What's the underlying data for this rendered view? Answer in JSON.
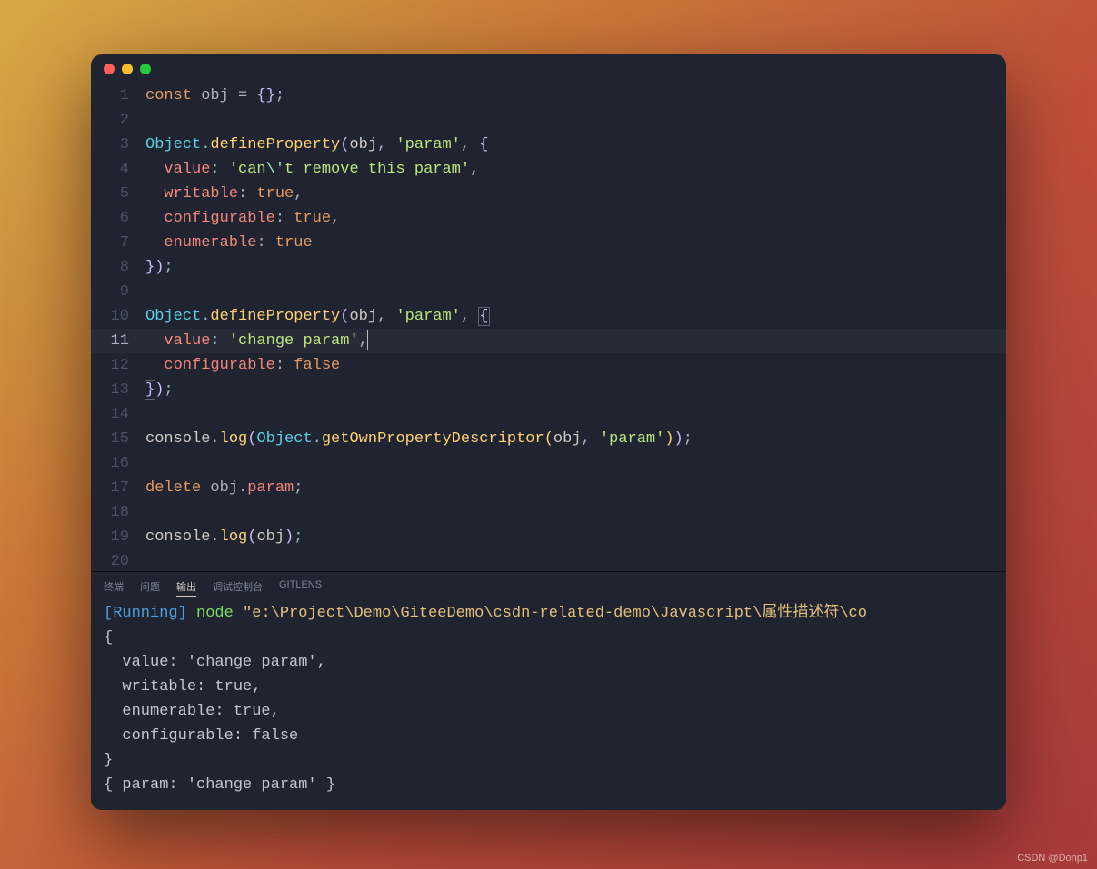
{
  "watermark": "CSDN @Donp1",
  "panel": {
    "tabs": [
      {
        "id": "terminal",
        "label": "终端",
        "active": false
      },
      {
        "id": "problems",
        "label": "问题",
        "active": false
      },
      {
        "id": "output",
        "label": "输出",
        "active": true
      },
      {
        "id": "debug",
        "label": "调试控制台",
        "active": false
      },
      {
        "id": "gitlens",
        "label": "GITLENS",
        "active": false
      }
    ],
    "run_tag": "[Running]",
    "run_cmd": " node ",
    "run_path": "\"e:\\Project\\Demo\\GiteeDemo\\csdn-related-demo\\Javascript\\属性描述符\\co",
    "output_lines": [
      "{",
      "  value: 'change param',",
      "  writable: true,",
      "  enumerable: true,",
      "  configurable: false",
      "}",
      "{ param: 'change param' }"
    ]
  },
  "editor": {
    "cursor_line": 11,
    "highlight_line": 11,
    "lines": [
      {
        "n": 1,
        "tokens": [
          [
            "kw",
            "const"
          ],
          [
            "p",
            " obj "
          ],
          [
            "p",
            "= "
          ],
          [
            "br",
            "{}"
          ],
          [
            "p",
            ";"
          ]
        ]
      },
      {
        "n": 2,
        "tokens": []
      },
      {
        "n": 3,
        "tokens": [
          [
            "obj",
            "Object"
          ],
          [
            "p",
            "."
          ],
          [
            "fn",
            "defineProperty"
          ],
          [
            "br",
            "("
          ],
          [
            "id",
            "obj"
          ],
          [
            "p",
            ", "
          ],
          [
            "str",
            "'param'"
          ],
          [
            "p",
            ", "
          ],
          [
            "br",
            "{"
          ]
        ]
      },
      {
        "n": 4,
        "tokens": [
          [
            "p",
            "  "
          ],
          [
            "prop",
            "value"
          ],
          [
            "p",
            ": "
          ],
          [
            "str",
            "'can"
          ],
          [
            "esc",
            "\\'"
          ],
          [
            "str",
            "t remove this param'"
          ],
          [
            "p",
            ","
          ]
        ]
      },
      {
        "n": 5,
        "tokens": [
          [
            "p",
            "  "
          ],
          [
            "prop",
            "writable"
          ],
          [
            "p",
            ": "
          ],
          [
            "kw",
            "true"
          ],
          [
            "p",
            ","
          ]
        ]
      },
      {
        "n": 6,
        "tokens": [
          [
            "p",
            "  "
          ],
          [
            "prop",
            "configurable"
          ],
          [
            "p",
            ": "
          ],
          [
            "kw",
            "true"
          ],
          [
            "p",
            ","
          ]
        ]
      },
      {
        "n": 7,
        "tokens": [
          [
            "p",
            "  "
          ],
          [
            "prop",
            "enumerable"
          ],
          [
            "p",
            ": "
          ],
          [
            "kw",
            "true"
          ]
        ]
      },
      {
        "n": 8,
        "tokens": [
          [
            "br",
            "}"
          ],
          [
            "br",
            ")"
          ],
          [
            "p",
            ";"
          ]
        ]
      },
      {
        "n": 9,
        "tokens": []
      },
      {
        "n": 10,
        "tokens": [
          [
            "obj",
            "Object"
          ],
          [
            "p",
            "."
          ],
          [
            "fn",
            "defineProperty"
          ],
          [
            "br",
            "("
          ],
          [
            "id",
            "obj"
          ],
          [
            "p",
            ", "
          ],
          [
            "str",
            "'param'"
          ],
          [
            "p",
            ", "
          ],
          [
            "br match-br",
            "{"
          ]
        ]
      },
      {
        "n": 11,
        "tokens": [
          [
            "p",
            "  "
          ],
          [
            "prop",
            "value"
          ],
          [
            "p",
            ": "
          ],
          [
            "str",
            "'change param'"
          ],
          [
            "p",
            ","
          ],
          [
            "cursor",
            ""
          ]
        ]
      },
      {
        "n": 12,
        "tokens": [
          [
            "p",
            "  "
          ],
          [
            "prop",
            "configurable"
          ],
          [
            "p",
            ": "
          ],
          [
            "false",
            "false"
          ]
        ]
      },
      {
        "n": 13,
        "tokens": [
          [
            "br match-br",
            "}"
          ],
          [
            "br",
            ")"
          ],
          [
            "p",
            ";"
          ]
        ]
      },
      {
        "n": 14,
        "tokens": []
      },
      {
        "n": 15,
        "tokens": [
          [
            "id",
            "console"
          ],
          [
            "p",
            "."
          ],
          [
            "fn",
            "log"
          ],
          [
            "br",
            "("
          ],
          [
            "obj",
            "Object"
          ],
          [
            "p",
            "."
          ],
          [
            "fn",
            "getOwnPropertyDescriptor"
          ],
          [
            "br2",
            "("
          ],
          [
            "id",
            "obj"
          ],
          [
            "p",
            ", "
          ],
          [
            "str",
            "'param'"
          ],
          [
            "br2",
            ")"
          ],
          [
            "br",
            ")"
          ],
          [
            "p",
            ";"
          ]
        ]
      },
      {
        "n": 16,
        "tokens": []
      },
      {
        "n": 17,
        "tokens": [
          [
            "kw",
            "delete"
          ],
          [
            "p",
            " obj"
          ],
          [
            "p",
            "."
          ],
          [
            "prop",
            "param"
          ],
          [
            "p",
            ";"
          ]
        ]
      },
      {
        "n": 18,
        "tokens": []
      },
      {
        "n": 19,
        "tokens": [
          [
            "id",
            "console"
          ],
          [
            "p",
            "."
          ],
          [
            "fn",
            "log"
          ],
          [
            "br",
            "("
          ],
          [
            "id",
            "obj"
          ],
          [
            "br",
            ")"
          ],
          [
            "p",
            ";"
          ]
        ]
      },
      {
        "n": 20,
        "tokens": []
      }
    ]
  }
}
